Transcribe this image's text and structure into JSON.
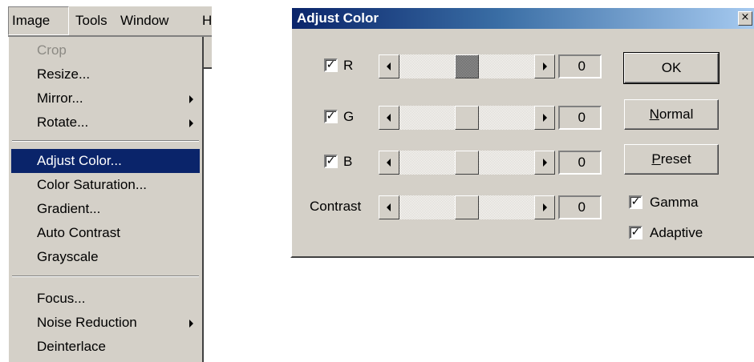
{
  "menubar": {
    "items": [
      {
        "label": "Image",
        "active": true
      },
      {
        "label": "Tools",
        "active": false
      },
      {
        "label": "Window",
        "active": false
      },
      {
        "label": "H",
        "active": false
      }
    ]
  },
  "image_menu": {
    "items": [
      {
        "label": "Crop",
        "disabled": true
      },
      {
        "label": "Resize..."
      },
      {
        "label": "Mirror...",
        "submenu": true
      },
      {
        "label": "Rotate...",
        "submenu": true
      },
      {
        "label": "Adjust Color...",
        "selected": true
      },
      {
        "label": "Color Saturation..."
      },
      {
        "label": "Gradient..."
      },
      {
        "label": "Auto Contrast"
      },
      {
        "label": "Grayscale"
      },
      {
        "label": "Focus..."
      },
      {
        "label": "Noise Reduction",
        "submenu": true
      },
      {
        "label": "Deinterlace"
      }
    ]
  },
  "dialog": {
    "title": "Adjust Color",
    "close_glyph": "×",
    "rows": [
      {
        "label": "R",
        "checkbox": true,
        "checked": true,
        "value": "0",
        "slider_position": 0.5,
        "focused": true
      },
      {
        "label": "G",
        "checkbox": true,
        "checked": true,
        "value": "0",
        "slider_position": 0.5,
        "focused": false
      },
      {
        "label": "B",
        "checkbox": true,
        "checked": true,
        "value": "0",
        "slider_position": 0.5,
        "focused": false
      },
      {
        "label": "Contrast",
        "checkbox": false,
        "value": "0",
        "slider_position": 0.5,
        "focused": false
      }
    ],
    "buttons": {
      "ok": "OK",
      "normal_first": "N",
      "normal_rest": "ormal",
      "preset_first": "P",
      "preset_rest": "reset"
    },
    "options": {
      "gamma_label": "Gamma",
      "gamma_checked": true,
      "adaptive_label": "Adaptive",
      "adaptive_checked": true
    },
    "check_glyph": "✓"
  },
  "colors": {
    "face": "#d4d0c8",
    "highlight": "#0a246a",
    "title_gradient_end": "#a6caf0"
  }
}
